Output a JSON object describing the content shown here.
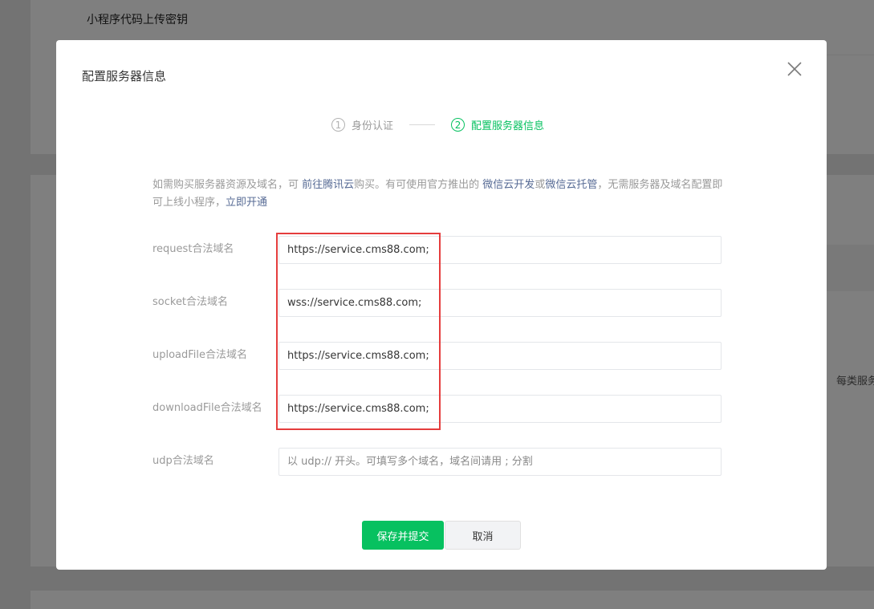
{
  "background": {
    "section_title": "小程序代码上传密钥",
    "right_text": "每类服务"
  },
  "dialog": {
    "title": "配置服务器信息",
    "steps": [
      {
        "num": "1",
        "label": "身份认证",
        "active": false
      },
      {
        "num": "2",
        "label": "配置服务器信息",
        "active": true
      }
    ],
    "hint": {
      "t1": "如需购买服务器资源及域名，可 ",
      "link1": "前往腾讯云",
      "t2": "购买。有可使用官方推出的 ",
      "link2": "微信云开发",
      "t3": "或",
      "link3": "微信云托管",
      "t4": "，无需服务器及域名配置即可上线小程序，",
      "link4": "立即开通"
    },
    "fields": [
      {
        "label": "request合法域名",
        "value": "https://service.cms88.com;",
        "placeholder": ""
      },
      {
        "label": "socket合法域名",
        "value": "wss://service.cms88.com;",
        "placeholder": ""
      },
      {
        "label": "uploadFile合法域名",
        "value": "https://service.cms88.com;",
        "placeholder": ""
      },
      {
        "label": "downloadFile合法域名",
        "value": "https://service.cms88.com;",
        "placeholder": ""
      },
      {
        "label": "udp合法域名",
        "value": "",
        "placeholder": "以 udp:// 开头。可填写多个域名，域名间请用 ; 分割"
      }
    ],
    "buttons": {
      "submit": "保存并提交",
      "cancel": "取消"
    }
  },
  "colors": {
    "primary": "#07c160",
    "link": "#576b95",
    "highlight": "#e53d3d"
  },
  "icons": {
    "close": "close-icon"
  }
}
